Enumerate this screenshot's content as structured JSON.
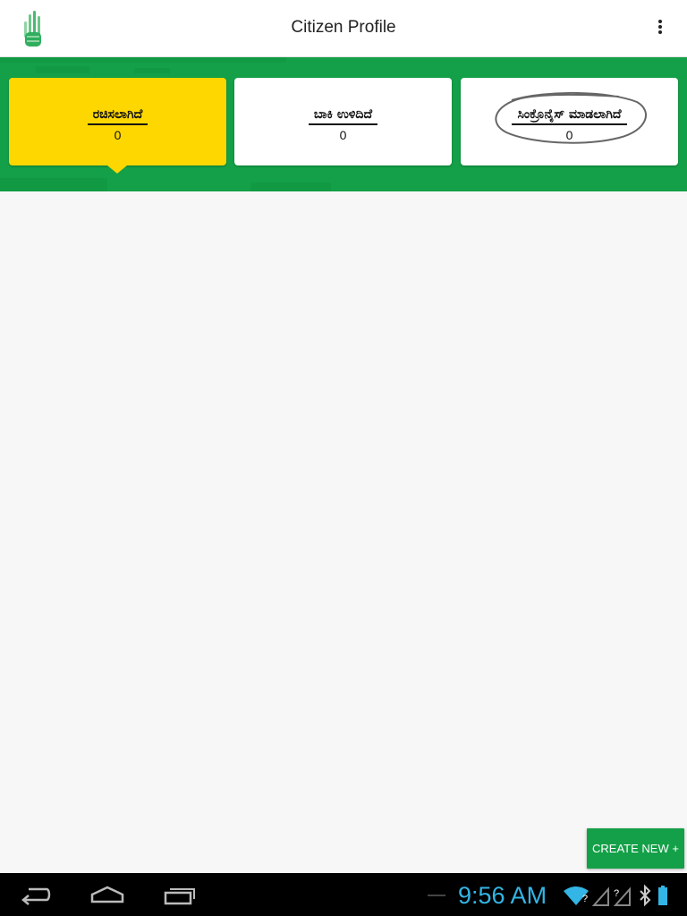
{
  "header": {
    "title": "Citizen Profile",
    "logo_icon": "hand-logo-icon",
    "menu_icon": "overflow-menu-icon"
  },
  "tabs": [
    {
      "label": "ರಚಿಸಲಾಗಿದೆ",
      "count": "0",
      "active": true
    },
    {
      "label": "ಬಾಕಿ ಉಳಿದಿದೆ",
      "count": "0",
      "active": false
    },
    {
      "label": "ಸಿಂಕ್ರೊನೈಸ್ ಮಾಡಲಾಗಿದೆ",
      "count": "0",
      "active": false
    }
  ],
  "actions": {
    "create_label": "CREATE NEW +"
  },
  "system_bar": {
    "time": "9:56 AM",
    "nav_icons": [
      "back-icon",
      "home-icon",
      "recents-icon"
    ],
    "status_icons": [
      "wifi-icon",
      "signal-icon",
      "bluetooth-icon",
      "battery-icon"
    ]
  },
  "colors": {
    "brand_green": "#14a048",
    "active_tab": "#ffd700",
    "clock": "#33b5e5"
  }
}
